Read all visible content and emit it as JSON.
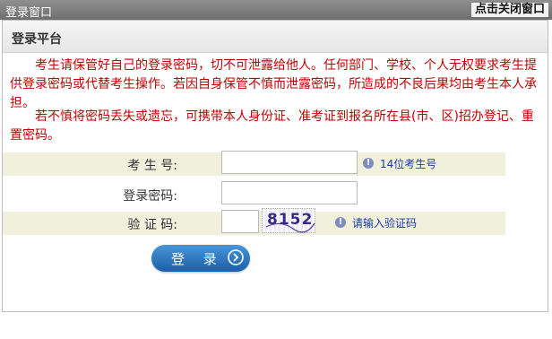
{
  "window": {
    "title": "登录窗口",
    "close_label": "点击关闭窗口"
  },
  "panel": {
    "title": "登录平台",
    "notice_1": "考生请保管好自己的登录密码，切不可泄露给他人。任何部门、学校、个人无权要求考生提供登录密码或代替考生操作。若因自身保管不慎而泄露密码，所造成的不良后果均由考生本人承担。",
    "notice_2": "若不慎将密码丢失或遗忘，可携带本人身份证、准考证到报名所在县(市、区)招办登记、重置密码。"
  },
  "form": {
    "exam_no_label": "考 生 号:",
    "exam_no_value": "",
    "exam_no_hint": "14位考生号",
    "password_label": "登录密码:",
    "password_value": "",
    "captcha_label": "验 证 码:",
    "captcha_value": "",
    "captcha_image_text": "8152",
    "captcha_hint": "请输入验证码"
  },
  "buttons": {
    "login_label": "登 录"
  },
  "colors": {
    "notice_text": "#c00000",
    "hint_text": "#1b3ea0",
    "row_shade": "#f0f0dd",
    "button_blue": "#1a5fa8"
  }
}
